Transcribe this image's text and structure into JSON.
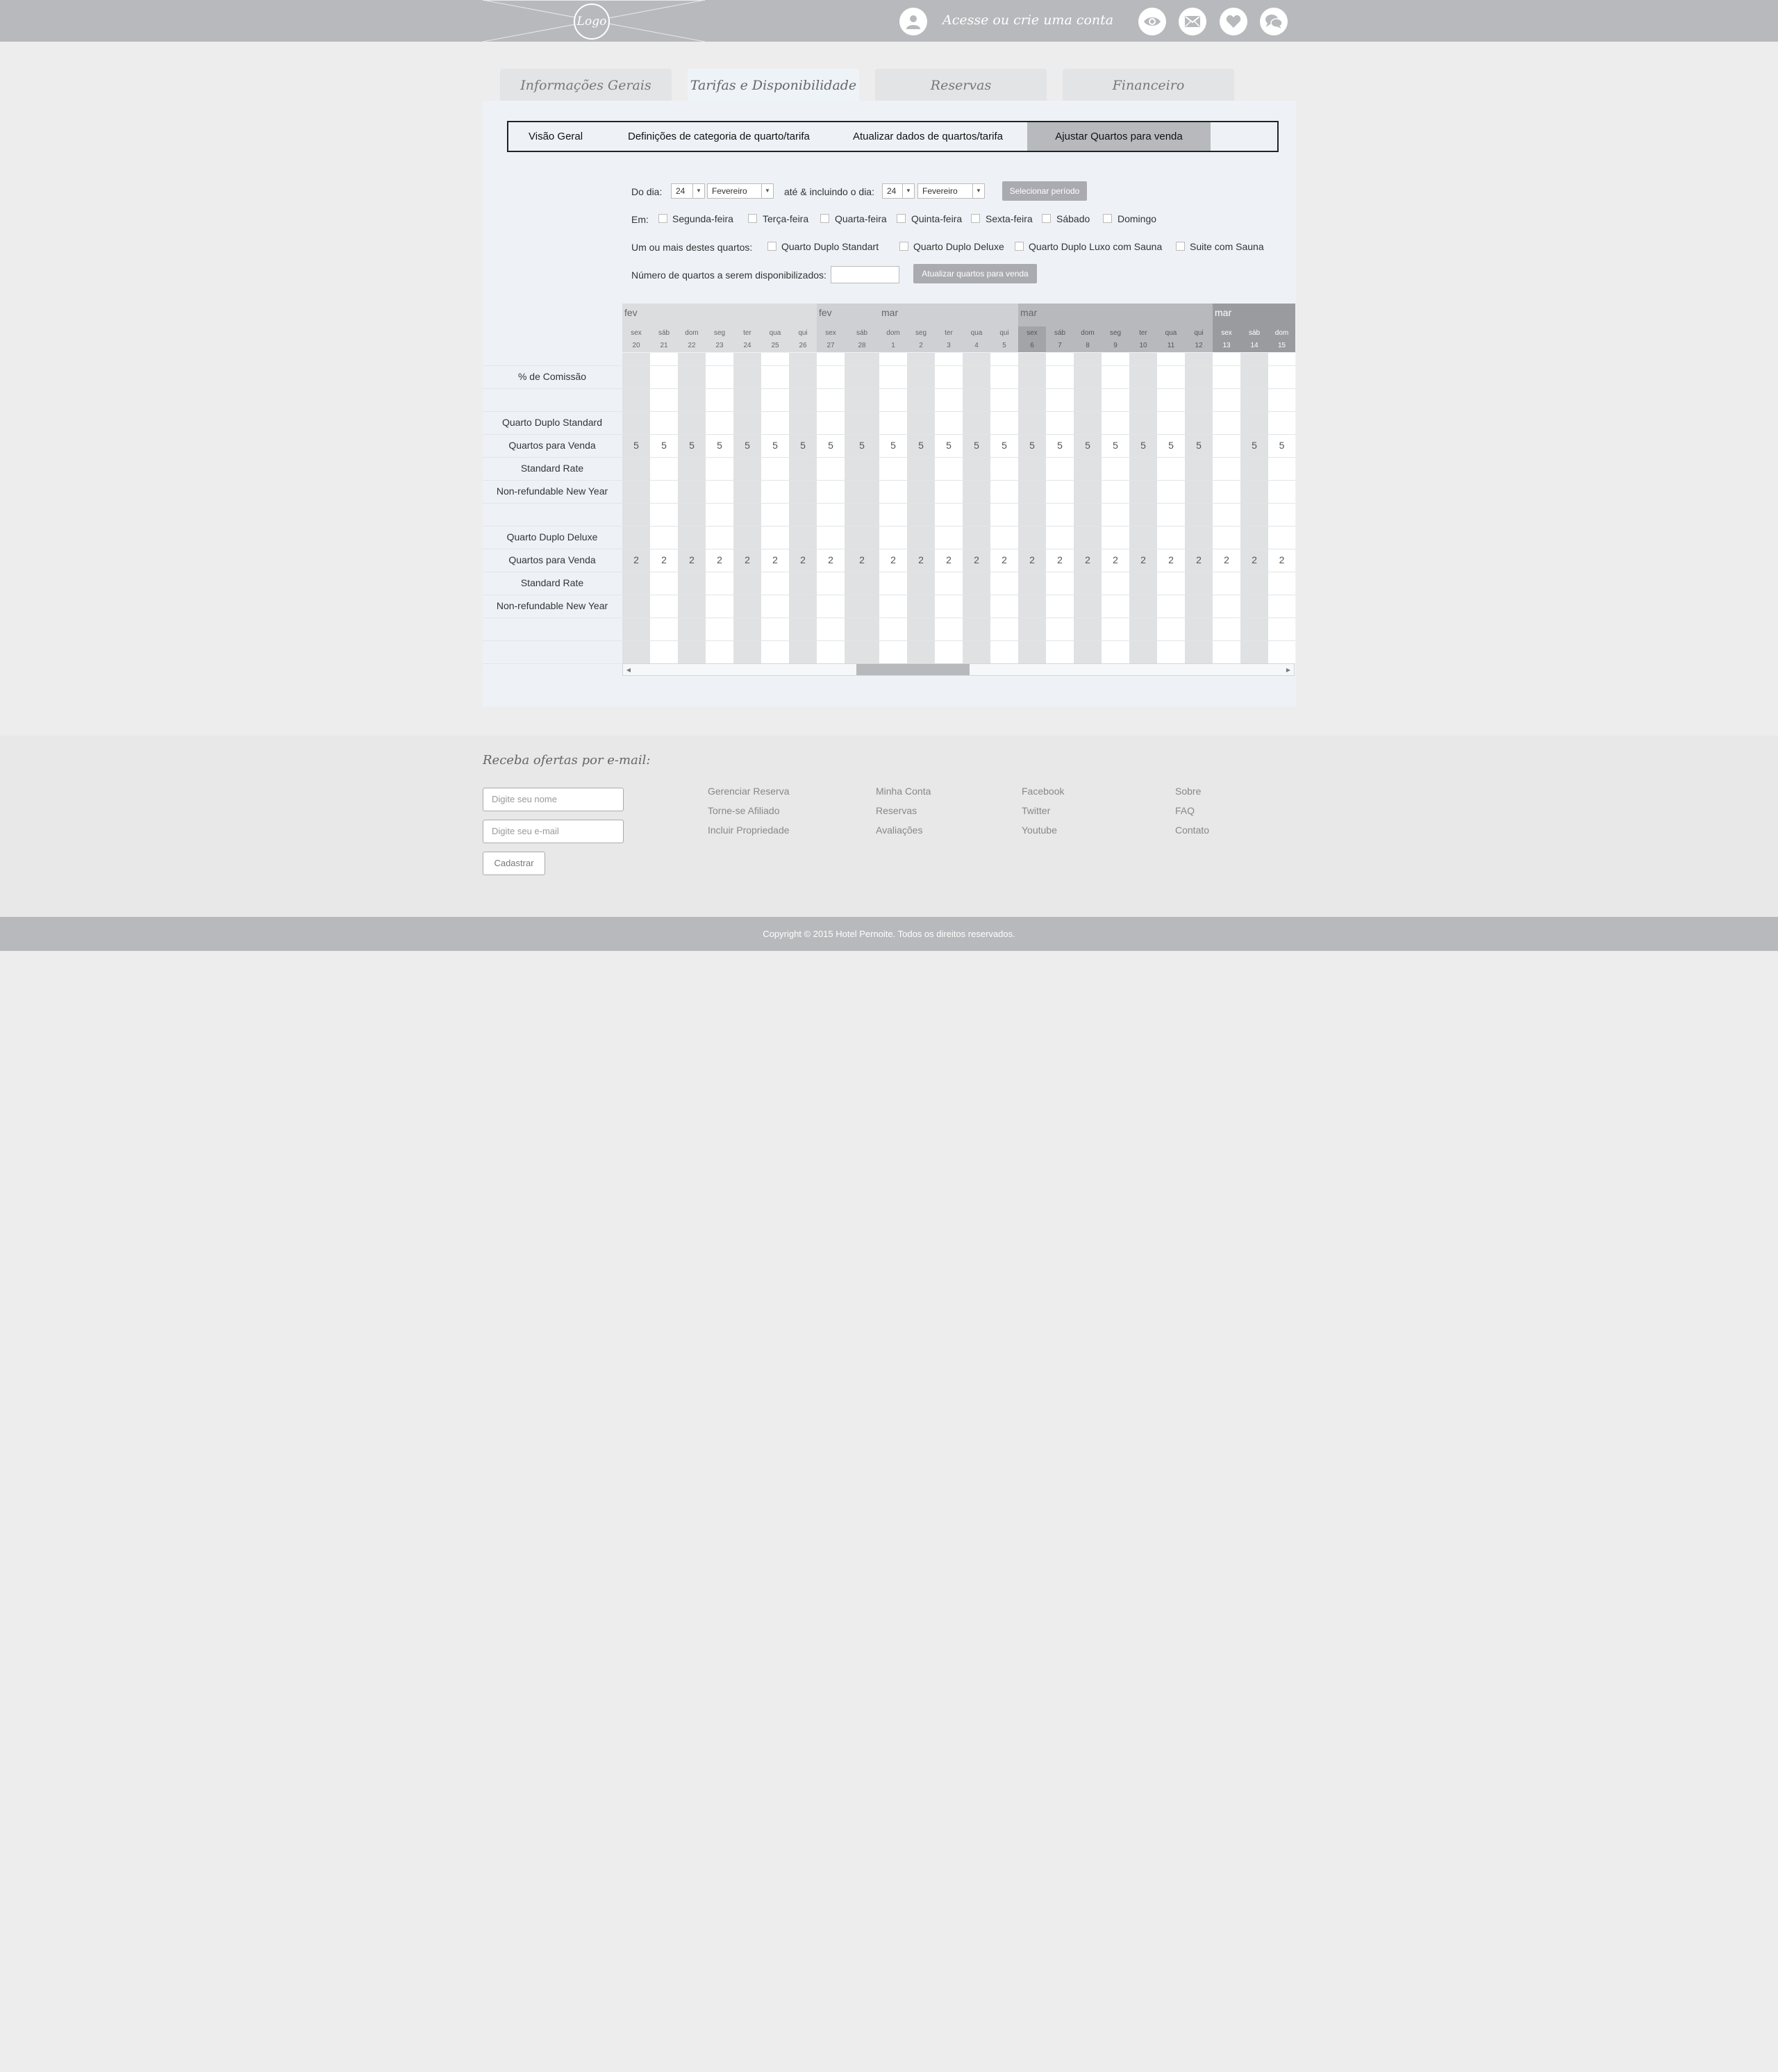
{
  "header": {
    "logo_text": "Logo",
    "account_link": "Acesse ou crie uma conta",
    "icons": [
      "eye-icon",
      "mail-icon",
      "heart-icon",
      "chat-icon"
    ]
  },
  "tabs": [
    {
      "label": "Informações Gerais",
      "active": false
    },
    {
      "label": "Tarifas e Disponibilidade",
      "active": true
    },
    {
      "label": "Reservas",
      "active": false
    },
    {
      "label": "Financeiro",
      "active": false
    }
  ],
  "subnav": [
    {
      "label": "Visão Geral",
      "active": false
    },
    {
      "label": "Definições de categoria de quarto/tarifa",
      "active": false
    },
    {
      "label": "Atualizar dados de quartos/tarifa",
      "active": false
    },
    {
      "label": "Ajustar Quartos para venda",
      "active": true
    }
  ],
  "filters": {
    "from_label": "Do dia:",
    "from_day": "24",
    "from_month": "Fevereiro",
    "to_label": "até & incluindo o dia:",
    "to_day": "24",
    "to_month": "Fevereiro",
    "select_period_button": "Selecionar período",
    "weekdays_label": "Em:",
    "weekdays": [
      "Segunda-feira",
      "Terça-feira",
      "Quarta-feira",
      "Quinta-feira",
      "Sexta-feira",
      "Sábado",
      "Domingo"
    ],
    "rooms_label": "Um ou mais destes quartos:",
    "rooms": [
      "Quarto Duplo Standart",
      "Quarto Duplo Deluxe",
      "Quarto Duplo Luxo com Sauna",
      "Suite com Sauna"
    ],
    "count_label": "Número de quartos a serem disponibilizados:",
    "count_value": "",
    "update_button": "Atualizar quartos para venda"
  },
  "grid": {
    "row_labels": [
      "% de Comissão",
      "",
      "Quarto Duplo Standard",
      "Quartos para Venda",
      "Standard Rate",
      "Non-refundable New Year",
      "",
      "Quarto Duplo Deluxe",
      "Quartos para Venda",
      "Standard Rate",
      "Non-refundable New Year",
      "",
      ""
    ],
    "months": [
      "fev",
      "fev",
      "mar",
      "mar",
      "mar"
    ],
    "days": [
      {
        "wd": "sex",
        "d": "20",
        "v1": "5",
        "v2": "2"
      },
      {
        "wd": "sáb",
        "d": "21",
        "v1": "5",
        "v2": "2"
      },
      {
        "wd": "dom",
        "d": "22",
        "v1": "5",
        "v2": "2"
      },
      {
        "wd": "seg",
        "d": "23",
        "v1": "5",
        "v2": "2"
      },
      {
        "wd": "ter",
        "d": "24",
        "v1": "5",
        "v2": "2"
      },
      {
        "wd": "qua",
        "d": "25",
        "v1": "5",
        "v2": "2"
      },
      {
        "wd": "qui",
        "d": "26",
        "v1": "5",
        "v2": "2"
      },
      {
        "wd": "sex",
        "d": "27",
        "v1": "5",
        "v2": "2"
      },
      {
        "wd": "sáb",
        "d": "28",
        "v1": "5",
        "v2": "2"
      },
      {
        "wd": "dom",
        "d": "1",
        "v1": "5",
        "v2": "2"
      },
      {
        "wd": "seg",
        "d": "2",
        "v1": "5",
        "v2": "2"
      },
      {
        "wd": "ter",
        "d": "3",
        "v1": "5",
        "v2": "2"
      },
      {
        "wd": "qua",
        "d": "4",
        "v1": "5",
        "v2": "2"
      },
      {
        "wd": "qui",
        "d": "5",
        "v1": "5",
        "v2": "2"
      },
      {
        "wd": "sex",
        "d": "6",
        "v1": "5",
        "v2": "2"
      },
      {
        "wd": "sáb",
        "d": "7",
        "v1": "5",
        "v2": "2"
      },
      {
        "wd": "dom",
        "d": "8",
        "v1": "5",
        "v2": "2"
      },
      {
        "wd": "seg",
        "d": "9",
        "v1": "5",
        "v2": "2"
      },
      {
        "wd": "ter",
        "d": "10",
        "v1": "5",
        "v2": "2"
      },
      {
        "wd": "qua",
        "d": "11",
        "v1": "5",
        "v2": "2"
      },
      {
        "wd": "qui",
        "d": "12",
        "v1": "5",
        "v2": "2"
      },
      {
        "wd": "sex",
        "d": "13",
        "v1": "",
        "v2": "2"
      },
      {
        "wd": "sáb",
        "d": "14",
        "v1": "5",
        "v2": "2"
      },
      {
        "wd": "dom",
        "d": "15",
        "v1": "5",
        "v2": "2"
      }
    ]
  },
  "footer": {
    "title": "Receba ofertas por e-mail:",
    "name_placeholder": "Digite seu nome",
    "email_placeholder": "Digite seu e-mail",
    "submit_label": "Cadastrar",
    "columns": [
      [
        "Gerenciar Reserva",
        "Torne-se Afiliado",
        "Incluir Propriedade"
      ],
      [
        "Minha Conta",
        "Reservas",
        "Avaliações"
      ],
      [
        "Facebook",
        "Twitter",
        "Youtube"
      ],
      [
        "Sobre",
        "FAQ",
        "Contato"
      ]
    ],
    "copyright": "Copyright © 2015 Hotel Pernoite. Todos os direitos reservados."
  }
}
